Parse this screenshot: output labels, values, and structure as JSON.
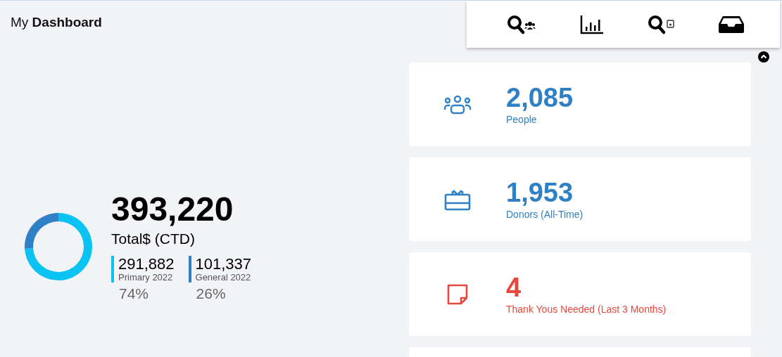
{
  "header": {
    "title": "My **Dashboard**"
  },
  "toolbar": [
    {
      "kind": "search-people"
    },
    {
      "kind": "chart"
    },
    {
      "kind": "search-saved"
    },
    {
      "kind": "inbox"
    }
  ],
  "summary": {
    "total": "393,220",
    "label": "Total$ (CTD)",
    "chart_data": {
      "type": "donut",
      "values": [
        74,
        26
      ]
    },
    "breakdown": [
      {
        "value": "291,882",
        "label": "Primary 2022",
        "percent": "74%",
        "color": "#0bc3f3"
      },
      {
        "value": "101,337",
        "label": "General 2022",
        "percent": "26%",
        "color": "#2f80c4"
      }
    ]
  },
  "cards": [
    {
      "kind": "people",
      "value": "2,085",
      "label": "People",
      "color": "#2f80c4"
    },
    {
      "kind": "gift",
      "value": "1,953",
      "label": "Donors (All-Time)",
      "color": "#2f80c4"
    },
    {
      "kind": "note",
      "value": "4",
      "label": "Thank Yous Needed (Last 3 Months)",
      "color": "#e8473e"
    },
    {
      "kind": "blank"
    }
  ]
}
